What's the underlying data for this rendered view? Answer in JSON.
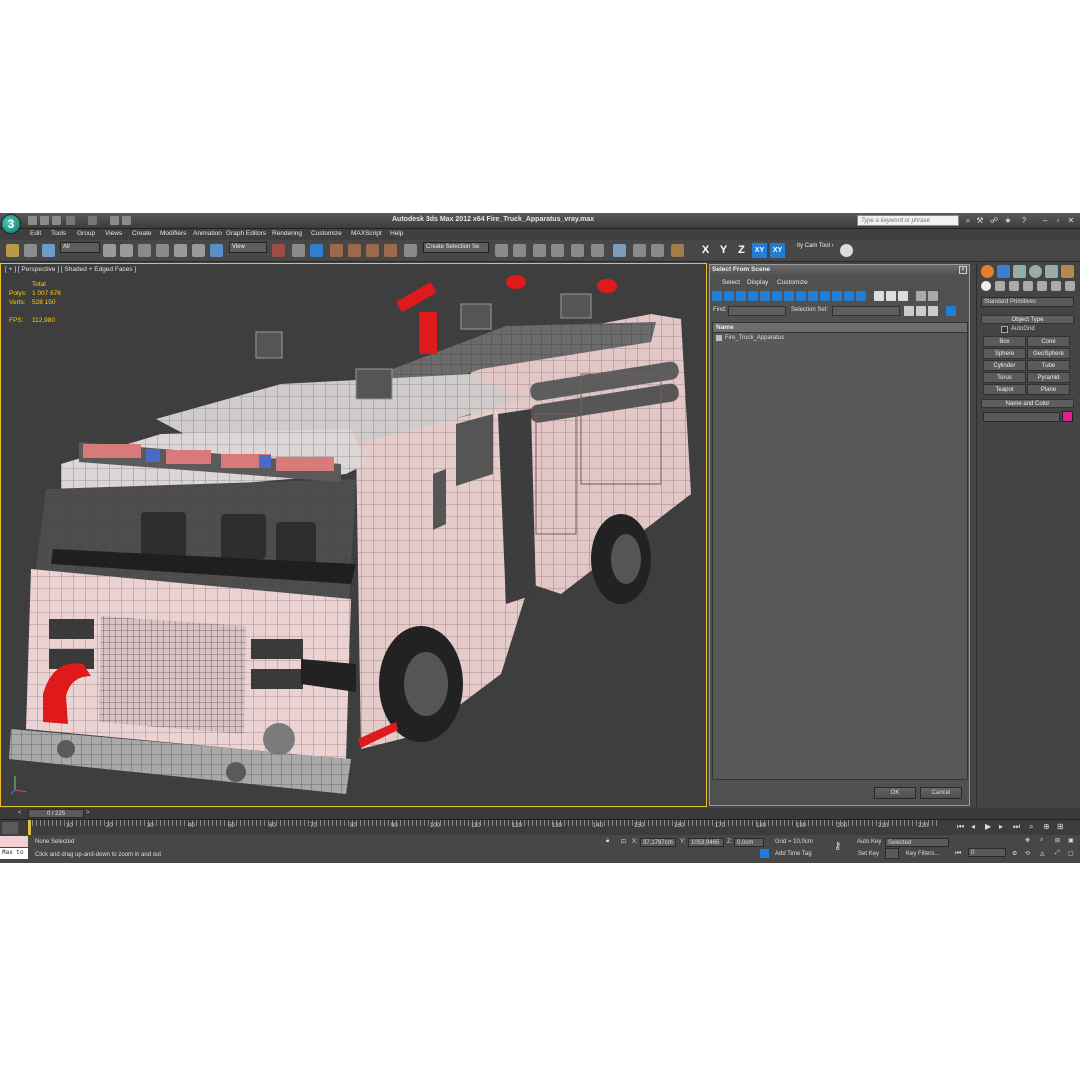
{
  "app": {
    "title": "Autodesk 3ds Max  2012 x64     Fire_Truck_Apparatus_vray.max",
    "logo": "3",
    "search_placeholder": "Type a keyword or phrase"
  },
  "menu": [
    "Edit",
    "Tools",
    "Group",
    "Views",
    "Create",
    "Modifiers",
    "Animation",
    "Graph Editors",
    "Rendering",
    "Customize",
    "MAXScript",
    "Help"
  ],
  "toolbar": {
    "selection_filter": "All",
    "reference_coord": "View",
    "named_selection": "Create Selection Se",
    "axes": [
      "X",
      "Y",
      "Z",
      "XY",
      "XY"
    ],
    "utility_label": "ity Cam Tool ‹"
  },
  "viewport": {
    "label": "[ + ] [ Perspective ] [ Shaded + Edged Faces ]",
    "stats_header": "Total",
    "polys_label": "Polys:",
    "polys_value": "1 007 676",
    "verts_label": "Verts:",
    "verts_value": "528 150",
    "fps_label": "FPS:",
    "fps_value": "112,980"
  },
  "dialog": {
    "title": "Select From Scene",
    "menu": [
      "Select",
      "Display",
      "Customize"
    ],
    "find_label": "Find:",
    "selection_set_label": "Selection Set:",
    "column_name": "Name",
    "items": [
      "Fire_Truck_Apparatus"
    ],
    "ok": "OK",
    "cancel": "Cancel"
  },
  "command_panel": {
    "category": "Standard Primitives",
    "object_type_rollout": "Object Type",
    "autogrid": "AutoGrid",
    "buttons": [
      "Box",
      "Cone",
      "Sphere",
      "GeoSphere",
      "Cylinder",
      "Tube",
      "Torus",
      "Pyramid",
      "Teapot",
      "Plane"
    ],
    "name_color_rollout": "Name and Color"
  },
  "timeline": {
    "frame": "0 / 225",
    "ticks": [
      "10",
      "20",
      "30",
      "40",
      "50",
      "60",
      "70",
      "80",
      "90",
      "100",
      "110",
      "120",
      "130",
      "140",
      "150",
      "160",
      "170",
      "180",
      "190",
      "200",
      "210",
      "220"
    ]
  },
  "status": {
    "maxscript_prompt": "Max to",
    "selection": "None Selected",
    "prompt": "Click and drag up-and-down to zoom in and out",
    "x_label": "X:",
    "x_value": "37,1797cm",
    "y_label": "Y:",
    "y_value": "1053,9465",
    "z_label": "Z:",
    "z_value": "0,0cm",
    "grid": "Grid = 10,0cm",
    "add_time_tag": "Add Time Tag",
    "auto_key": "Auto Key",
    "set_key": "Set Key",
    "key_mode": "Selected",
    "key_filters": "Key Filters...",
    "current_frame": "0"
  },
  "colors": {
    "accent_blue": "#1f7fd6",
    "truck_body": "#e8c8c8",
    "truck_red": "#e01a1a",
    "viewport_border": "#e7c12a",
    "stats_yellow": "#ffd000",
    "object_color": "#e0208a"
  }
}
